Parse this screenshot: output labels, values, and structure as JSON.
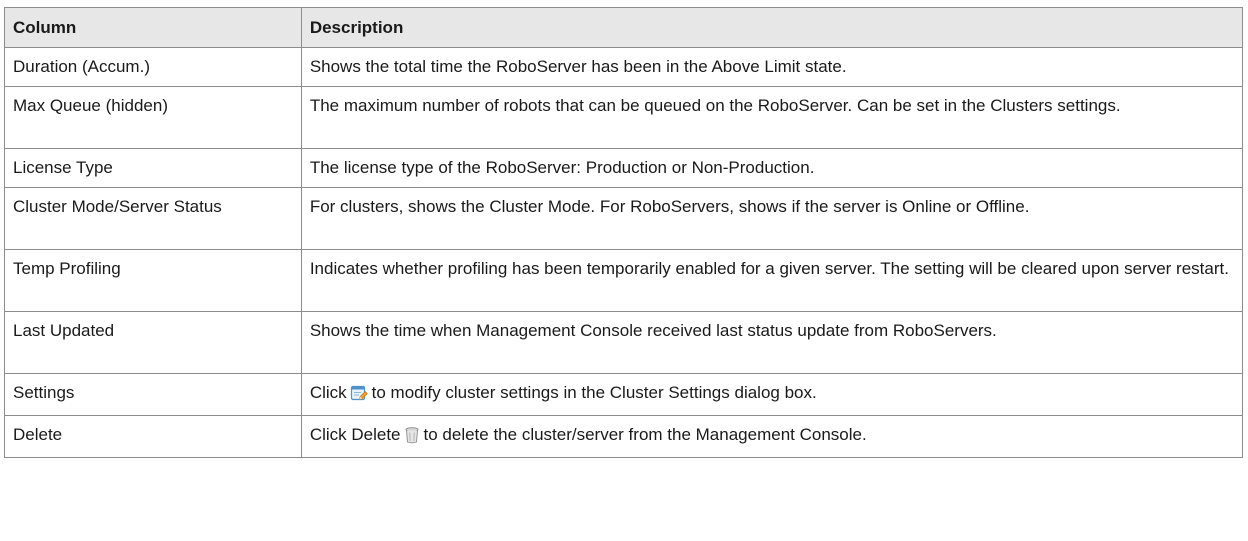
{
  "table": {
    "headers": [
      "Column",
      "Description"
    ],
    "rows": [
      {
        "column": "Duration (Accum.)",
        "description": "Shows the total time the RoboServer has been in the Above Limit state."
      },
      {
        "column": "Max Queue (hidden)",
        "description": "The maximum number of robots that can be queued on the RoboServer. Can be set in the Clusters settings."
      },
      {
        "column": "License Type",
        "description": "The license type of the RoboServer: Production or Non-Production."
      },
      {
        "column": "Cluster Mode/Server Status",
        "description": "For clusters, shows the Cluster Mode. For RoboServers, shows if the server is Online or Offline."
      },
      {
        "column": "Temp Profiling",
        "description": "Indicates whether profiling has been temporarily enabled for a given server. The setting will be cleared upon server restart."
      },
      {
        "column": "Last Updated",
        "description": "Shows the time when Management Console received last status update from RoboServers."
      },
      {
        "column": "Settings",
        "description_before": "Click",
        "icon": "edit-settings-icon",
        "description_after": "to modify cluster settings in the Cluster Settings dialog box."
      },
      {
        "column": "Delete",
        "description_before": "Click Delete",
        "icon": "trash-icon",
        "description_after": "to delete the cluster/server from the Management Console."
      }
    ]
  },
  "colors": {
    "header_bg": "#e7e7e7",
    "border": "#8c8c8c",
    "text": "#1a1a1a"
  }
}
